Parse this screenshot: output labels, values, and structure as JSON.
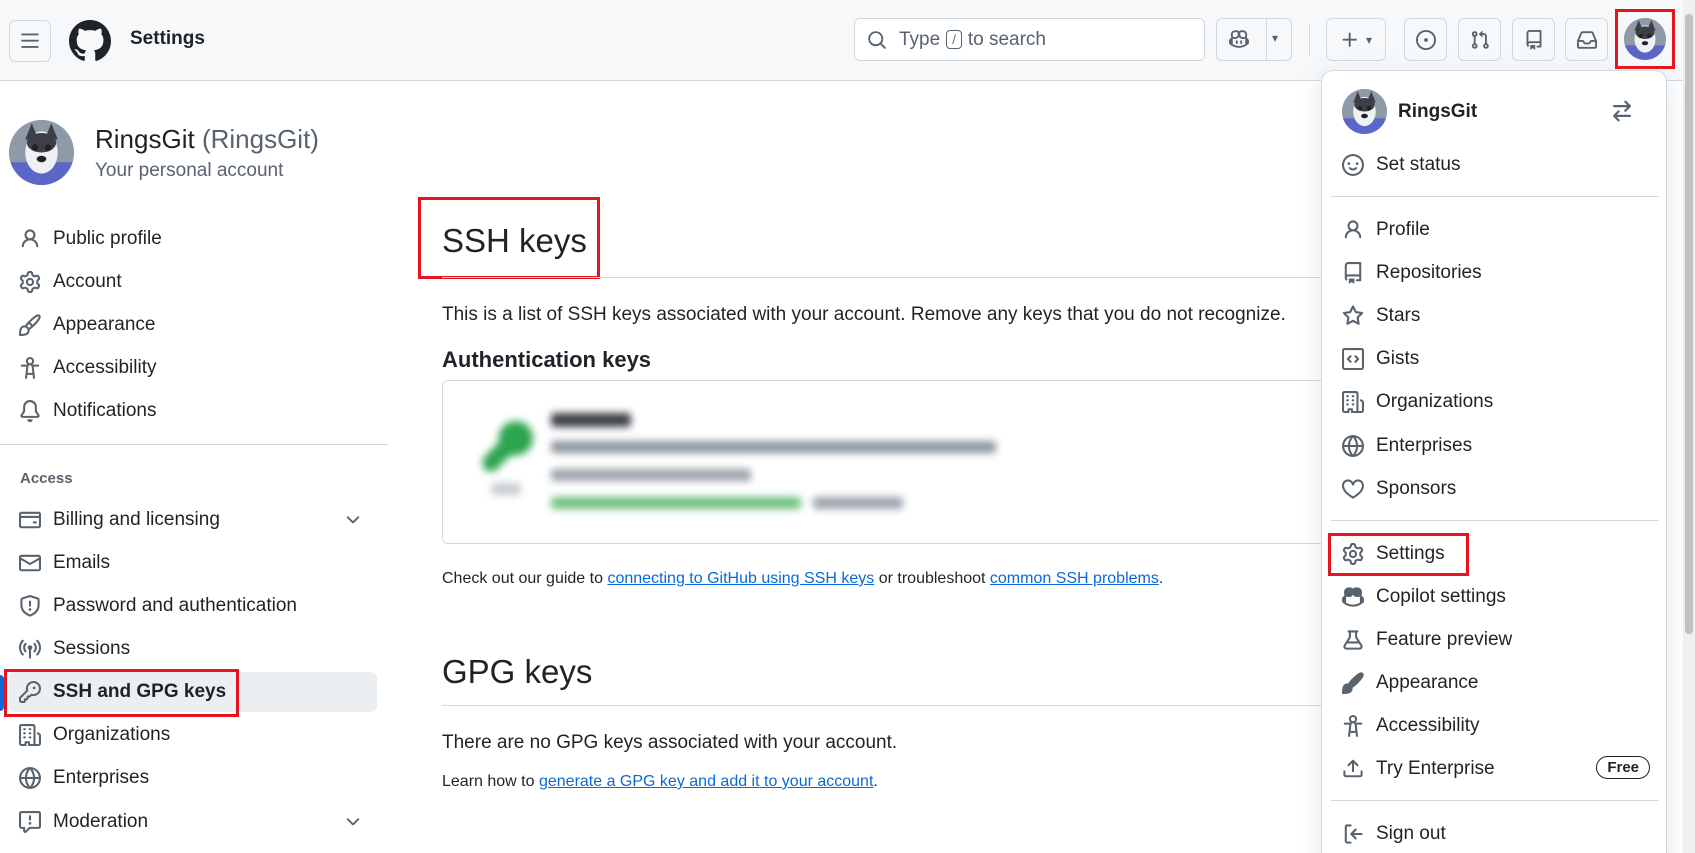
{
  "header": {
    "title": "Settings",
    "search_prefix": "Type",
    "search_key": "/",
    "search_suffix": "to search"
  },
  "account": {
    "name": "RingsGit",
    "login": "(RingsGit)",
    "subtitle": "Your personal account"
  },
  "sidebar": {
    "items": [
      {
        "label": "Public profile",
        "icon": "person-icon"
      },
      {
        "label": "Account",
        "icon": "gear-icon"
      },
      {
        "label": "Appearance",
        "icon": "paintbrush-icon"
      },
      {
        "label": "Accessibility",
        "icon": "accessibility-icon"
      },
      {
        "label": "Notifications",
        "icon": "bell-icon"
      }
    ],
    "access_label": "Access",
    "access_items": [
      {
        "label": "Billing and licensing",
        "icon": "credit-card-icon"
      },
      {
        "label": "Emails",
        "icon": "mail-icon"
      },
      {
        "label": "Password and authentication",
        "icon": "shield-icon"
      },
      {
        "label": "Sessions",
        "icon": "broadcast-icon"
      },
      {
        "label": "SSH and GPG keys",
        "icon": "key-icon"
      },
      {
        "label": "Organizations",
        "icon": "organization-icon"
      },
      {
        "label": "Enterprises",
        "icon": "globe-icon"
      },
      {
        "label": "Moderation",
        "icon": "report-icon"
      }
    ]
  },
  "main": {
    "ssh_title": "SSH keys",
    "ssh_desc": "This is a list of SSH keys associated with your account. Remove any keys that you do not recognize.",
    "auth_heading": "Authentication keys",
    "guide_prefix": "Check out our guide to",
    "guide_link1": "connecting to GitHub using SSH keys",
    "guide_middle": "or troubleshoot",
    "guide_link2": "common SSH problems",
    "guide_end": ".",
    "gpg_title": "GPG keys",
    "gpg_desc": "There are no GPG keys associated with your account.",
    "gpg_learn_prefix": "Learn how to",
    "gpg_learn_link": "generate a GPG key and add it to your account",
    "gpg_learn_end": "."
  },
  "user_menu": {
    "username": "RingsGit",
    "set_status": "Set status",
    "group1": [
      "Profile",
      "Repositories",
      "Stars",
      "Gists",
      "Organizations",
      "Enterprises",
      "Sponsors"
    ],
    "group2": [
      "Settings",
      "Copilot settings",
      "Feature preview",
      "Appearance",
      "Accessibility",
      "Try Enterprise"
    ],
    "free_badge": "Free",
    "sign_out": "Sign out"
  },
  "colors": {
    "highlight": "#e5141e",
    "link": "#0969da",
    "active_bar": "#0969da"
  }
}
